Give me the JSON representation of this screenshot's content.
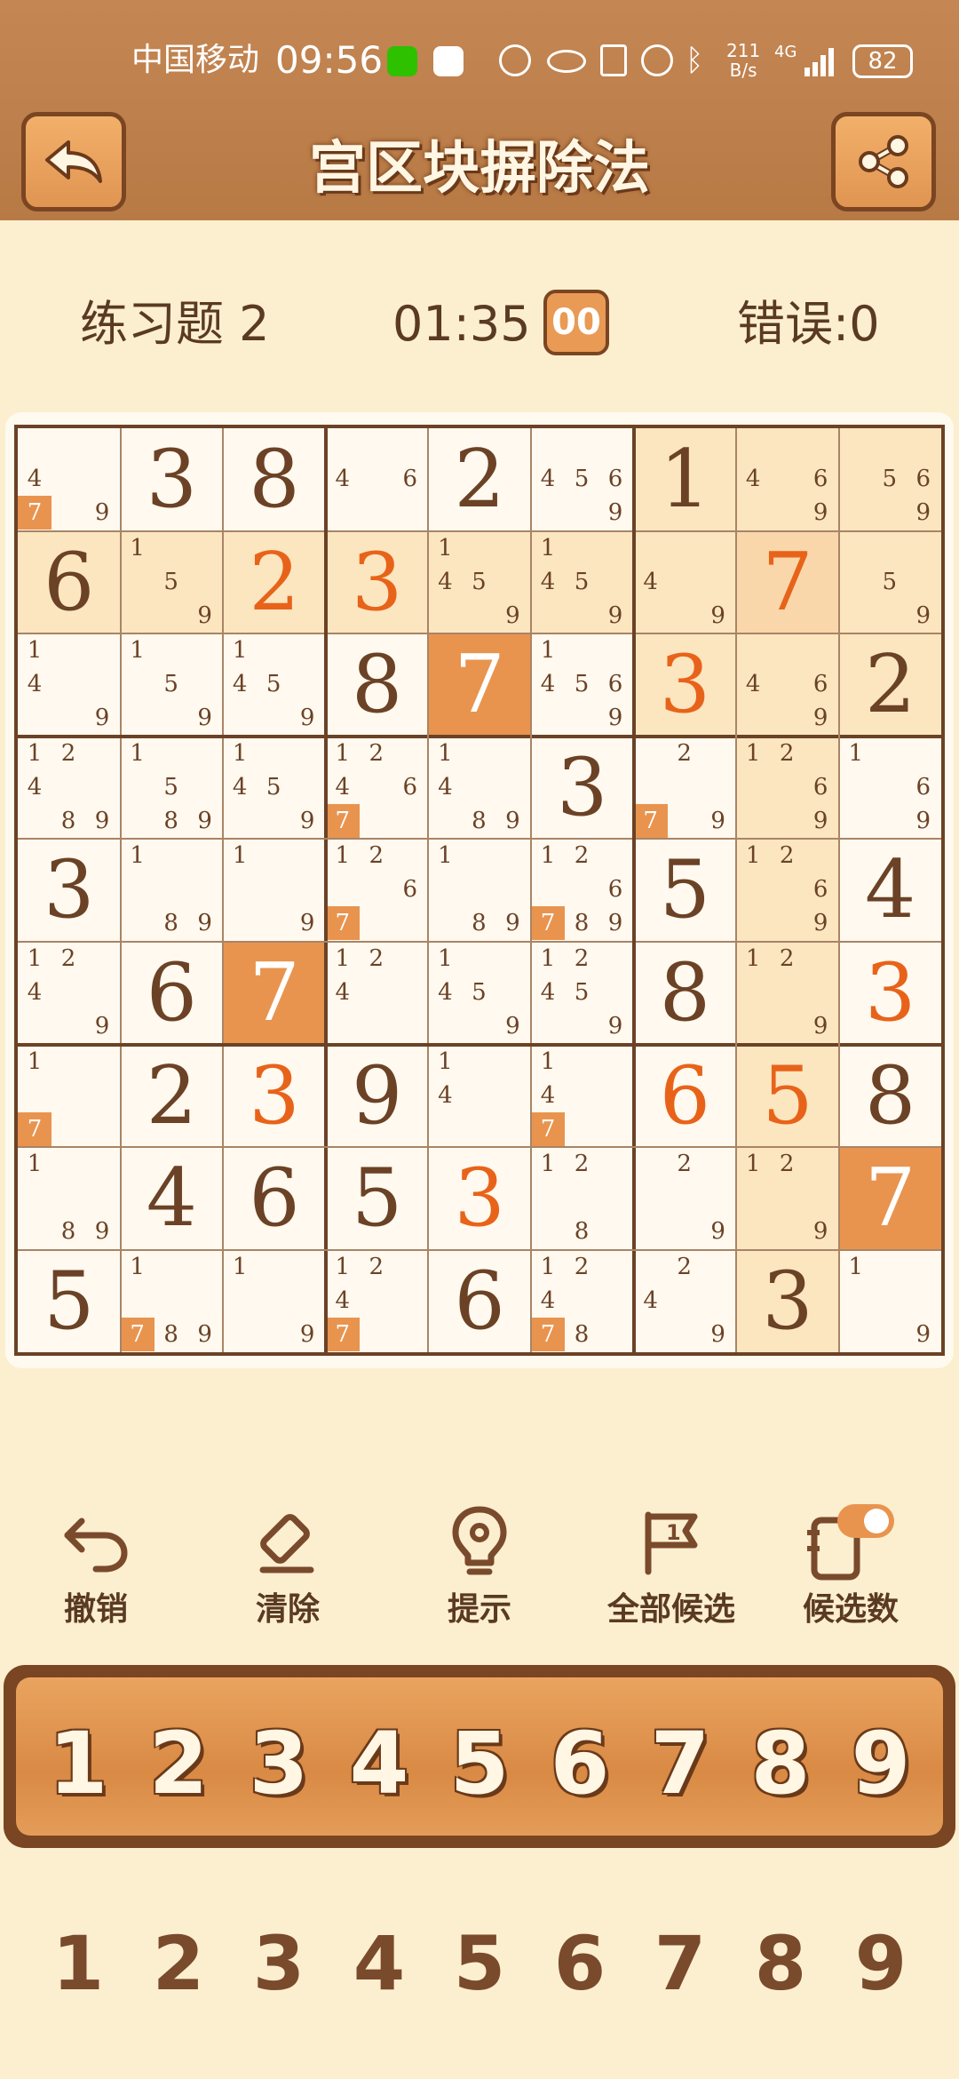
{
  "status_bar": {
    "carrier": "中国移动",
    "time": "09:56",
    "net_speed_top": "211",
    "net_speed_bottom": "B/s",
    "network": "4G",
    "battery": "82"
  },
  "header": {
    "title": "宫区块摒除法",
    "back_icon": "back-arrow-icon",
    "share_icon": "share-icon"
  },
  "info": {
    "level": "练习题 2",
    "timer": "01:35",
    "pause_label": "00",
    "errors": "错误:0"
  },
  "colors": {
    "given": "#6b4226",
    "filled": "#e8631a",
    "highlight_strong": "#e8944f",
    "highlight_light": "#fbe6c0",
    "highlight_mid": "#f9d7ab",
    "candidate_hl": "#e8944f"
  },
  "grid": {
    "values": [
      [
        "",
        "3",
        "8",
        "",
        "2",
        "",
        "1",
        "",
        ""
      ],
      [
        "6",
        "",
        "2",
        "3",
        "",
        "",
        "",
        "7",
        ""
      ],
      [
        "",
        "",
        "",
        "8",
        "7",
        "",
        "3",
        "",
        "2"
      ],
      [
        "",
        "",
        "",
        "",
        "",
        "3",
        "",
        "",
        ""
      ],
      [
        "3",
        "",
        "",
        "",
        "",
        "",
        "5",
        "",
        "4"
      ],
      [
        "",
        "6",
        "7",
        "",
        "",
        "",
        "8",
        "",
        "3"
      ],
      [
        "",
        "2",
        "3",
        "9",
        "",
        "",
        "6",
        "5",
        "8"
      ],
      [
        "",
        "4",
        "6",
        "5",
        "3",
        "",
        "",
        "",
        "7"
      ],
      [
        "5",
        "",
        "",
        "",
        "6",
        "",
        "",
        "3",
        ""
      ]
    ],
    "user_filled": [
      [
        0,
        0,
        0,
        0,
        0,
        0,
        0,
        0,
        0
      ],
      [
        0,
        0,
        1,
        1,
        0,
        0,
        0,
        1,
        0
      ],
      [
        0,
        0,
        0,
        0,
        0,
        0,
        1,
        0,
        0
      ],
      [
        0,
        0,
        0,
        0,
        0,
        0,
        0,
        0,
        0
      ],
      [
        0,
        0,
        0,
        0,
        0,
        0,
        0,
        0,
        0
      ],
      [
        0,
        0,
        0,
        0,
        0,
        0,
        0,
        0,
        1
      ],
      [
        0,
        0,
        1,
        0,
        0,
        0,
        1,
        1,
        0
      ],
      [
        0,
        0,
        0,
        0,
        1,
        0,
        0,
        0,
        0
      ],
      [
        0,
        0,
        0,
        0,
        0,
        0,
        0,
        0,
        0
      ]
    ],
    "cell_bg": [
      [
        0,
        0,
        0,
        0,
        0,
        0,
        1,
        1,
        1
      ],
      [
        1,
        1,
        1,
        1,
        1,
        1,
        1,
        2,
        1
      ],
      [
        0,
        0,
        0,
        0,
        3,
        0,
        1,
        1,
        1
      ],
      [
        0,
        0,
        0,
        0,
        0,
        0,
        0,
        1,
        0
      ],
      [
        0,
        0,
        0,
        0,
        0,
        0,
        0,
        1,
        0
      ],
      [
        0,
        0,
        3,
        0,
        0,
        0,
        0,
        1,
        0
      ],
      [
        0,
        0,
        0,
        0,
        0,
        0,
        0,
        1,
        0
      ],
      [
        0,
        0,
        0,
        0,
        0,
        0,
        0,
        1,
        3
      ],
      [
        0,
        0,
        0,
        0,
        0,
        0,
        0,
        1,
        0
      ]
    ],
    "candidates": [
      [
        [
          "4",
          "7",
          "9"
        ],
        [],
        [],
        [
          "4",
          "6"
        ],
        [],
        [
          "4",
          "5",
          "6",
          "9"
        ],
        [],
        [
          "4",
          "6",
          "9"
        ],
        [
          "5",
          "6",
          "9"
        ]
      ],
      [
        [],
        [
          "1",
          "5",
          "9"
        ],
        [],
        [],
        [
          "1",
          "4",
          "5",
          "9"
        ],
        [
          "1",
          "4",
          "5",
          "9"
        ],
        [
          "4",
          "9"
        ],
        [],
        [
          "5",
          "9"
        ]
      ],
      [
        [
          "1",
          "4",
          "9"
        ],
        [
          "1",
          "5",
          "9"
        ],
        [
          "1",
          "4",
          "5",
          "9"
        ],
        [],
        [],
        [
          "1",
          "4",
          "5",
          "6",
          "9"
        ],
        [],
        [
          "4",
          "6",
          "9"
        ],
        []
      ],
      [
        [
          "1",
          "2",
          "4",
          "8",
          "9"
        ],
        [
          "1",
          "5",
          "8",
          "9"
        ],
        [
          "1",
          "4",
          "5",
          "9"
        ],
        [
          "1",
          "2",
          "4",
          "6",
          "7"
        ],
        [
          "1",
          "4",
          "8",
          "9"
        ],
        [],
        [
          "2",
          "7",
          "9"
        ],
        [
          "1",
          "2",
          "6",
          "9"
        ],
        [
          "1",
          "6",
          "9"
        ]
      ],
      [
        [],
        [
          "1",
          "8",
          "9"
        ],
        [
          "1",
          "9"
        ],
        [
          "1",
          "2",
          "6",
          "7"
        ],
        [
          "1",
          "8",
          "9"
        ],
        [
          "1",
          "2",
          "6",
          "7",
          "8",
          "9"
        ],
        [],
        [
          "1",
          "2",
          "6",
          "9"
        ],
        []
      ],
      [
        [
          "1",
          "2",
          "4",
          "9"
        ],
        [],
        [],
        [
          "1",
          "2",
          "4"
        ],
        [
          "1",
          "4",
          "5",
          "9"
        ],
        [
          "1",
          "2",
          "4",
          "5",
          "9"
        ],
        [],
        [
          "1",
          "2",
          "9"
        ],
        []
      ],
      [
        [
          "1",
          "7"
        ],
        [],
        [],
        [],
        [
          "1",
          "4"
        ],
        [
          "1",
          "4",
          "7"
        ],
        [],
        [],
        []
      ],
      [
        [
          "1",
          "8",
          "9"
        ],
        [],
        [],
        [],
        [],
        [
          "1",
          "2",
          "8"
        ],
        [
          "2",
          "9"
        ],
        [
          "1",
          "2",
          "9"
        ],
        []
      ],
      [
        [],
        [
          "1",
          "7",
          "8",
          "9"
        ],
        [
          "1",
          "9"
        ],
        [
          "1",
          "2",
          "4",
          "7"
        ],
        [],
        [
          "1",
          "2",
          "4",
          "7",
          "8"
        ],
        [
          "2",
          "4",
          "9"
        ],
        [],
        [
          "1",
          "9"
        ]
      ]
    ],
    "highlighted_candidate": "7"
  },
  "tools": [
    {
      "label": "撤销",
      "icon": "undo-icon"
    },
    {
      "label": "清除",
      "icon": "eraser-icon"
    },
    {
      "label": "提示",
      "icon": "lightbulb-icon"
    },
    {
      "label": "全部候选",
      "icon": "flag-icon"
    },
    {
      "label": "候选数",
      "icon": "notes-toggle-icon"
    }
  ],
  "number_pad": [
    "1",
    "2",
    "3",
    "4",
    "5",
    "6",
    "7",
    "8",
    "9"
  ],
  "candidate_pad": [
    "1",
    "2",
    "3",
    "4",
    "5",
    "6",
    "7",
    "8",
    "9"
  ]
}
